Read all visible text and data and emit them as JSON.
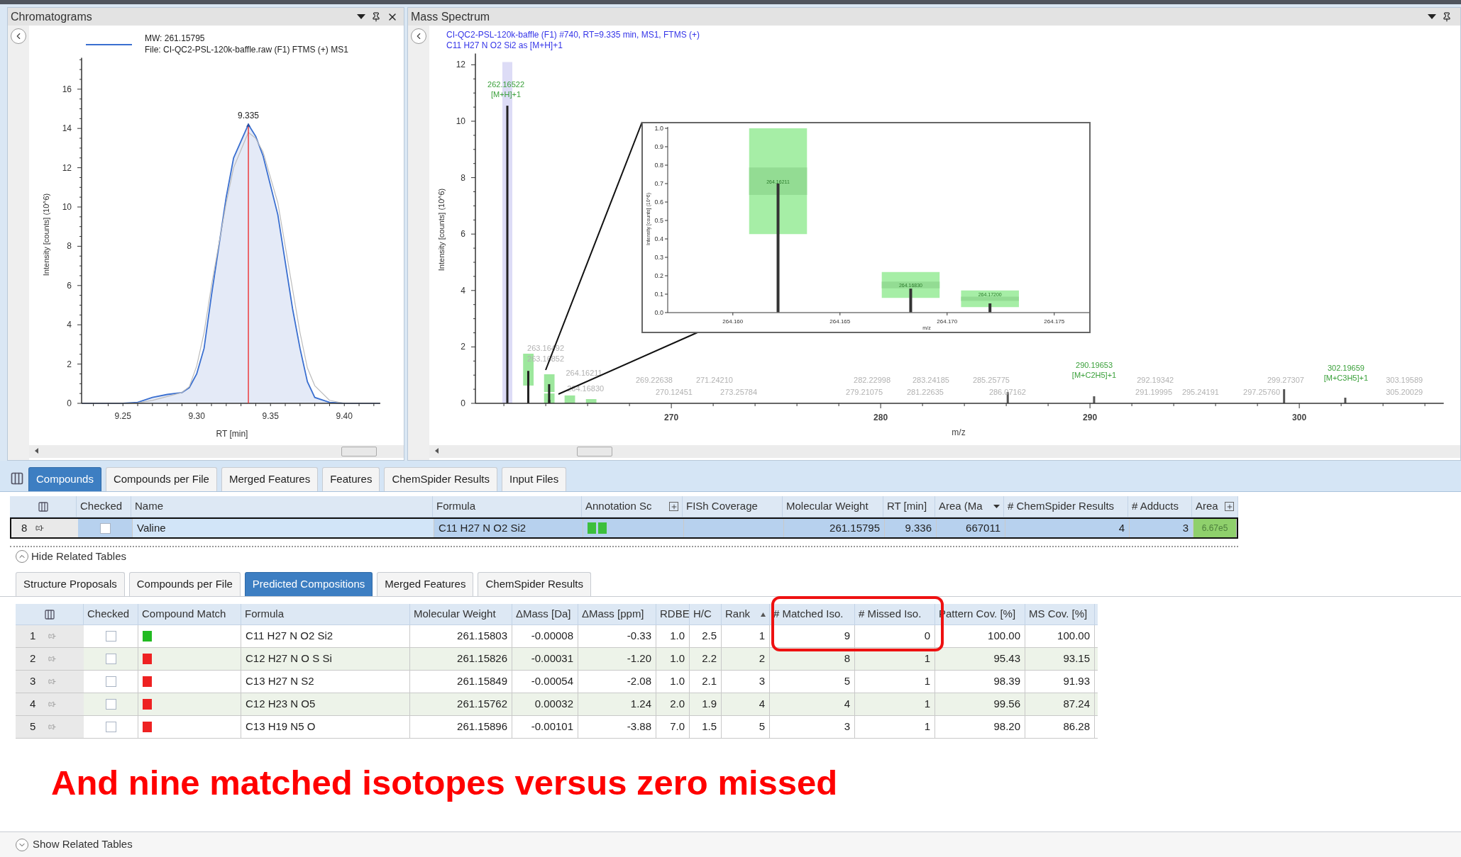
{
  "chromatograms": {
    "title": "Chromatograms",
    "legend_file": "File: CI-QC2-PSL-120k-baffle.raw (F1) FTMS (+) MS1",
    "chart_data": {
      "type": "line",
      "xlabel": "RT [min]",
      "ylabel": "Intensity [counts] (10^6)",
      "xlim": [
        9.222,
        9.424
      ],
      "ylim": [
        0,
        17.6
      ],
      "xticks": [
        {
          "value": 9.25,
          "label": "9.25"
        },
        {
          "value": 9.3,
          "label": "9.30"
        },
        {
          "value": 9.35,
          "label": "9.35"
        },
        {
          "value": 9.4,
          "label": "9.40"
        }
      ],
      "yticks": [
        0,
        2,
        4,
        6,
        8,
        10,
        12,
        14,
        16
      ],
      "x": [
        9.222,
        9.25,
        9.26,
        9.27,
        9.28,
        9.29,
        9.295,
        9.3,
        9.305,
        9.31,
        9.32,
        9.325,
        9.335,
        9.34,
        9.345,
        9.355,
        9.365,
        9.37,
        9.375,
        9.38,
        9.39,
        9.4,
        9.424
      ],
      "series": [
        {
          "name": "MW: 261.15795",
          "color": "#3a6fd0",
          "values": [
            0,
            0,
            0.05,
            0.3,
            0.45,
            0.55,
            0.8,
            1.5,
            2.8,
            5.5,
            10.5,
            12.5,
            14.2,
            13.6,
            12.6,
            9.6,
            4.8,
            2.8,
            1.1,
            0.3,
            0.05,
            0,
            0
          ]
        },
        {
          "color": "#bcbcbc",
          "values": [
            0,
            0,
            0.02,
            0.15,
            0.35,
            0.55,
            0.85,
            1.9,
            3.6,
            6.0,
            10.2,
            12.0,
            13.8,
            13.5,
            12.8,
            10.2,
            5.8,
            3.6,
            1.8,
            0.9,
            0.15,
            0,
            0
          ]
        }
      ],
      "annotations": [
        {
          "text": "9.335",
          "x": 9.335,
          "y": 14.2
        }
      ]
    }
  },
  "mass_spectrum": {
    "title": "Mass Spectrum",
    "header_lines": [
      "CI-QC2-PSL-120k-baffle (F1) #740, RT=9.335 min, MS1, FTMS (+)",
      "C11 H27 N O2 Si2 as [M+H]+1"
    ],
    "chart_data": {
      "type": "bar",
      "xlabel": "m/z",
      "ylabel": "Intensity [counts] (10^6)",
      "xlim": [
        260.64,
        306.9
      ],
      "ylim": [
        0,
        12.4
      ],
      "xticks": [
        270,
        280,
        290,
        300
      ],
      "yticks": [
        0,
        2,
        4,
        6,
        8,
        10,
        12
      ],
      "x": [
        262.16522,
        263.16492,
        264.16211,
        264.1683,
        286.07162,
        290.19653,
        299.27307,
        302.19659
      ],
      "values": [
        10.55,
        1.15,
        0.68,
        0.12,
        0.4,
        0.25,
        0.5,
        0.2
      ]
    },
    "peak_labels": [
      {
        "text": "262.16522",
        "adduct": "[M+H]+1",
        "kind": "matched"
      },
      {
        "text": "263.16492",
        "kind": "other"
      },
      {
        "text": "263.16852",
        "kind": "other"
      },
      {
        "text": "264.16211",
        "kind": "other"
      },
      {
        "text": "264.16830",
        "kind": "other"
      },
      {
        "text": "269.22638",
        "kind": "other"
      },
      {
        "text": "270.12451",
        "kind": "other"
      },
      {
        "text": "271.24210",
        "kind": "other"
      },
      {
        "text": "273.25784",
        "kind": "other"
      },
      {
        "text": "282.22998",
        "kind": "other"
      },
      {
        "text": "279.21075",
        "kind": "other"
      },
      {
        "text": "283.24185",
        "kind": "other"
      },
      {
        "text": "281.22635",
        "kind": "other"
      },
      {
        "text": "285.25775",
        "kind": "other"
      },
      {
        "text": "286.07162",
        "kind": "other"
      },
      {
        "text": "290.19653",
        "adduct": "[M+C2H5]+1",
        "kind": "matched"
      },
      {
        "text": "292.19342",
        "kind": "other"
      },
      {
        "text": "291.19995",
        "kind": "other"
      },
      {
        "text": "295.24191",
        "kind": "other"
      },
      {
        "text": "299.27307",
        "kind": "other"
      },
      {
        "text": "297.25760",
        "kind": "other"
      },
      {
        "text": "302.19659",
        "adduct": "[M+C3H5]+1",
        "kind": "matched"
      },
      {
        "text": "303.19589",
        "kind": "other"
      },
      {
        "text": "305.20029",
        "kind": "other"
      }
    ],
    "inset": {
      "peak_labels": [
        "264.16211",
        "264.16830",
        "264.17200"
      ],
      "chart_data": {
        "type": "bar",
        "xlabel": "m/z",
        "ylabel": "Intensity [counts] (10^6)",
        "xlim": [
          264.15696,
          264.17663
        ],
        "ylim": [
          0,
          1.0
        ],
        "xticks": [
          {
            "value": 264.16,
            "label": "264.160"
          },
          {
            "value": 264.165,
            "label": "264.165"
          },
          {
            "value": 264.17,
            "label": "264.170"
          },
          {
            "value": 264.175,
            "label": "264.175"
          }
        ],
        "yticks": [
          {
            "value": 0,
            "label": "0.0"
          },
          {
            "value": 0.1,
            "label": "0.1"
          },
          {
            "value": 0.2,
            "label": "0.2"
          },
          {
            "value": 0.3,
            "label": "0.3"
          },
          {
            "value": 0.4,
            "label": "0.4"
          },
          {
            "value": 0.5,
            "label": "0.5"
          },
          {
            "value": 0.6,
            "label": "0.6"
          },
          {
            "value": 0.7,
            "label": "0.7"
          },
          {
            "value": 0.8,
            "label": "0.8"
          },
          {
            "value": 0.9,
            "label": "0.9"
          },
          {
            "value": 1.0,
            "label": "1.0"
          }
        ],
        "x": [
          264.16211,
          264.1683,
          264.172
        ],
        "values": [
          0.7,
          0.13,
          0.05
        ]
      }
    }
  },
  "main_tabs": [
    {
      "label": "Compounds",
      "selected": true
    },
    {
      "label": "Compounds per File",
      "selected": false
    },
    {
      "label": "Merged Features",
      "selected": false
    },
    {
      "label": "Features",
      "selected": false
    },
    {
      "label": "ChemSpider Results",
      "selected": false
    },
    {
      "label": "Input Files",
      "selected": false
    }
  ],
  "compounds_table": {
    "columns": [
      {
        "label": "Checked",
        "kind": "plain"
      },
      {
        "label": "Name",
        "kind": "plain"
      },
      {
        "label": "Formula",
        "kind": "plain"
      },
      {
        "label": "Annotation Sc",
        "kind": "expand"
      },
      {
        "label": "FISh Coverage",
        "kind": "plain"
      },
      {
        "label": "Molecular Weight",
        "kind": "plain"
      },
      {
        "label": "RT [min]",
        "kind": "plain"
      },
      {
        "label": "Area (Ma",
        "kind": "filter"
      },
      {
        "label": "# ChemSpider Results",
        "kind": "plain"
      },
      {
        "label": "# Adducts",
        "kind": "plain"
      },
      {
        "label": "Area",
        "kind": "expand"
      }
    ],
    "rows": [
      {
        "index": "8",
        "selected": true,
        "checked": false,
        "name": "Valine",
        "formula": "C11 H27 N O2 Si2",
        "annotation_scores": [
          {
            "color": "#3cbf3c"
          },
          {
            "color": "#3cbf3c"
          }
        ],
        "molecular_weight": "261.15795",
        "rt": "9.336",
        "area_max": "667011",
        "chemspider_results": "4",
        "adducts": "3",
        "area": "6.67e5"
      }
    ]
  },
  "hide_related": "Hide Related Tables",
  "sub_tabs": [
    {
      "label": "Structure Proposals",
      "selected": false
    },
    {
      "label": "Compounds per File",
      "selected": false
    },
    {
      "label": "Predicted Compositions",
      "selected": true
    },
    {
      "label": "Merged Features",
      "selected": false
    },
    {
      "label": "ChemSpider Results",
      "selected": false
    }
  ],
  "compositions_table": {
    "columns": [
      {
        "label": "Checked",
        "kind": "plain"
      },
      {
        "label": "Compound Match",
        "kind": "plain"
      },
      {
        "label": "Formula",
        "kind": "plain"
      },
      {
        "label": "Molecular Weight",
        "kind": "plain"
      },
      {
        "label": "ΔMass [Da]",
        "kind": "plain"
      },
      {
        "label": "ΔMass [ppm]",
        "kind": "plain"
      },
      {
        "label": "RDBE",
        "kind": "plain"
      },
      {
        "label": "H/C",
        "kind": "plain"
      },
      {
        "label": "Rank",
        "kind": "sort"
      },
      {
        "label": "# Matched Iso.",
        "kind": "plain"
      },
      {
        "label": "# Missed Iso.",
        "kind": "plain"
      },
      {
        "label": "Pattern Cov. [%]",
        "kind": "plain"
      },
      {
        "label": "MS Cov. [%]",
        "kind": "plain"
      }
    ],
    "rows": [
      {
        "index": "1",
        "checked": false,
        "color": "#22bb22",
        "formula": "C11 H27 N O2 Si2",
        "molecular_weight": "261.15803",
        "dmass_da": "-0.00008",
        "dmass_ppm": "-0.33",
        "rdbe": "1.0",
        "hc": "2.5",
        "rank": "1",
        "matched": "9",
        "missed": "0",
        "pattern_cov": "100.00",
        "ms_cov": "100.00"
      },
      {
        "index": "2",
        "checked": false,
        "color": "#ee2222",
        "formula": "C12 H27 N O S Si",
        "molecular_weight": "261.15826",
        "dmass_da": "-0.00031",
        "dmass_ppm": "-1.20",
        "rdbe": "1.0",
        "hc": "2.2",
        "rank": "2",
        "matched": "8",
        "missed": "1",
        "pattern_cov": "95.43",
        "ms_cov": "93.15"
      },
      {
        "index": "3",
        "checked": false,
        "color": "#ee2222",
        "formula": "C13 H27 N S2",
        "molecular_weight": "261.15849",
        "dmass_da": "-0.00054",
        "dmass_ppm": "-2.08",
        "rdbe": "1.0",
        "hc": "2.1",
        "rank": "3",
        "matched": "5",
        "missed": "1",
        "pattern_cov": "98.39",
        "ms_cov": "91.93"
      },
      {
        "index": "4",
        "checked": false,
        "color": "#ee2222",
        "formula": "C12 H23 N O5",
        "molecular_weight": "261.15762",
        "dmass_da": "0.00032",
        "dmass_ppm": "1.24",
        "rdbe": "2.0",
        "hc": "1.9",
        "rank": "4",
        "matched": "4",
        "missed": "1",
        "pattern_cov": "99.56",
        "ms_cov": "87.24"
      },
      {
        "index": "5",
        "checked": false,
        "color": "#ee2222",
        "formula": "C13 H19 N5 O",
        "molecular_weight": "261.15896",
        "dmass_da": "-0.00101",
        "dmass_ppm": "-3.88",
        "rdbe": "7.0",
        "hc": "1.5",
        "rank": "5",
        "matched": "3",
        "missed": "1",
        "pattern_cov": "98.20",
        "ms_cov": "86.28"
      }
    ]
  },
  "callout": "And nine matched isotopes versus zero missed",
  "show_related": "Show Related Tables"
}
